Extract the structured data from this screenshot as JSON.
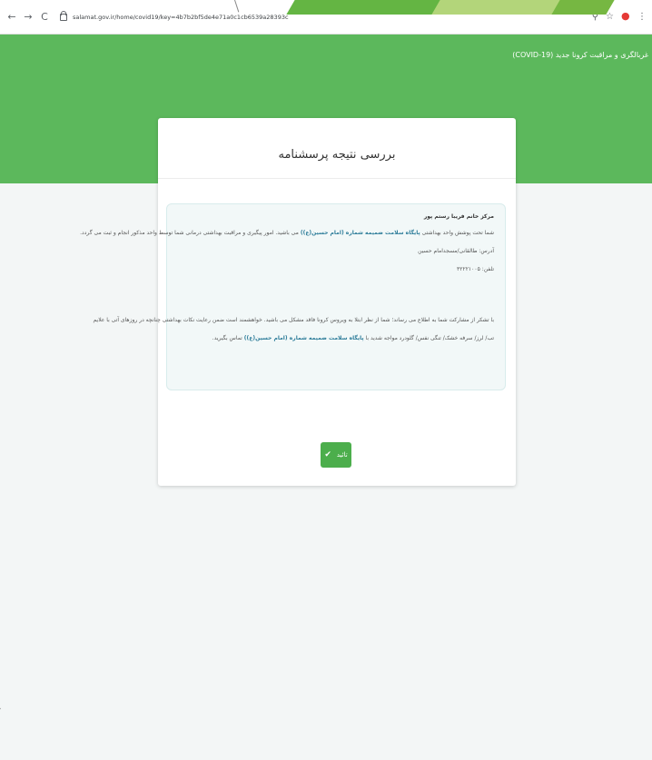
{
  "browser": {
    "url": "salamat.gov.ir/home/covid19/key=4b7b2bf5de4e71a0c1cb6539a28393c",
    "nav": {
      "back": "←",
      "forward": "→",
      "reload": "C"
    }
  },
  "header": {
    "title": "غربالگری و مراقبت کرونا جدید (COVID-19)"
  },
  "card": {
    "title": "بررسی نتیجه پرسشنامه",
    "info": {
      "name": "مرکز خانم فریبا رستم پور",
      "line1_pre": "شما تحت پوشش واحد بهداشتی",
      "line1_link": "پایگاه سلامت ضمیمه شماره (امام حسین(ع))",
      "line1_post": "می باشید. امور پیگیری و مراقبت بهداشتی درمانی شما توسط واحد مذکور انجام و ثبت می گردد.",
      "address": "آدرس: طالقانی/مسجدامام حسین",
      "phone": "تلفن: ۳۲۲۲۱۰۰۵",
      "para1": "با تشکر از مشارکت شما به اطلاع می رساند؛ شما از نظر ابتلا به ویروس کرونا فاقد مشکل می باشید. خواهشمند است ضمن رعایت نکات بهداشتی چنانچه در روزهای آتی با علایم",
      "para2_pre": "تب/ لرز/ سرفه خشک/ تنگی نفس/ گلودرد مواجه شدید با",
      "para2_link": "پایگاه سلامت ضمیمه شماره (امام حسین(ع))",
      "para2_post": "تماس بگیرید."
    },
    "confirm_label": "تائید"
  },
  "colors": {
    "header_green": "#5cb85c",
    "button_green": "#4cae4c",
    "link_teal": "#2e7d9a"
  }
}
